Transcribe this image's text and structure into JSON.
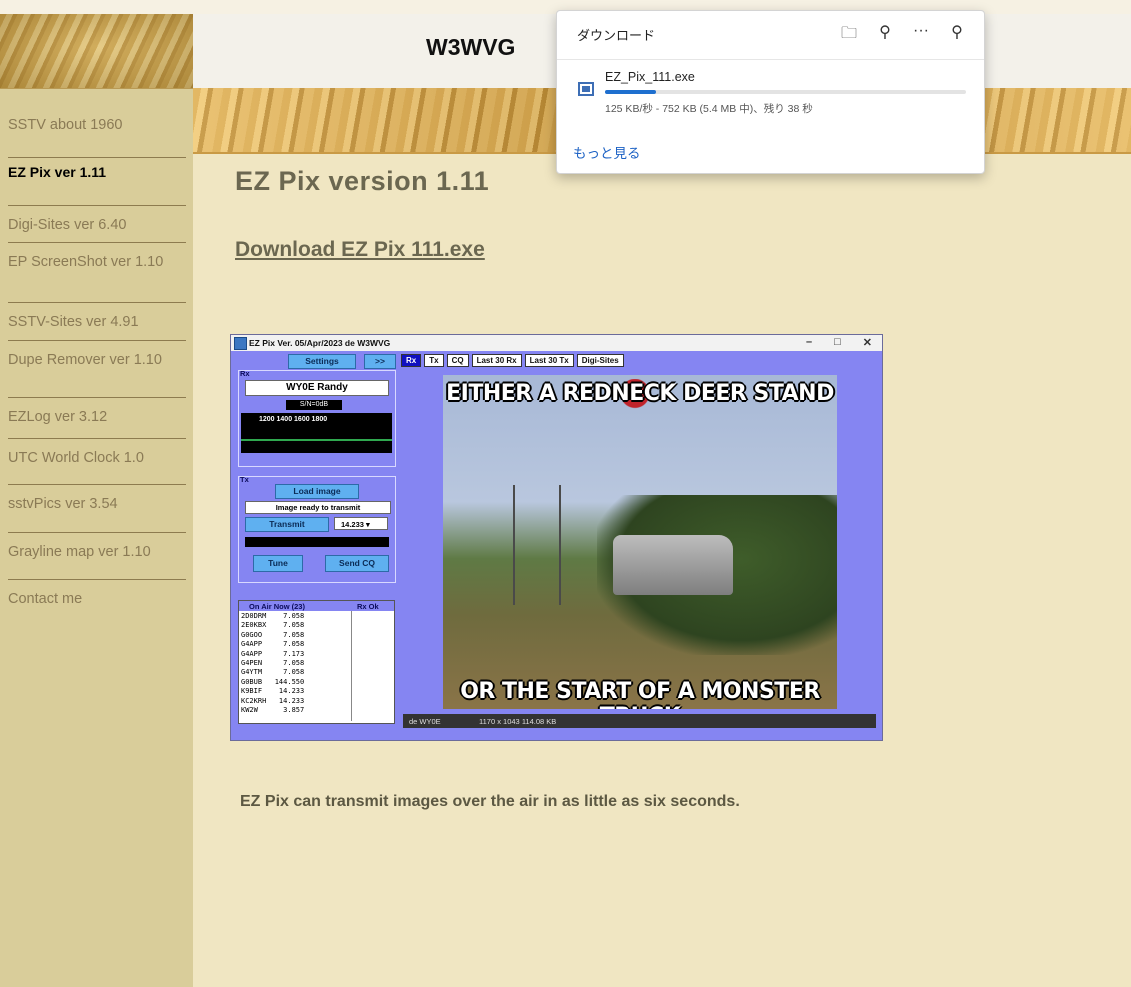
{
  "banner": {
    "title": "W3WVG"
  },
  "sidebar": {
    "items": [
      {
        "label": "SSTV about 1960",
        "top": 0,
        "h": 52
      },
      {
        "label": "EZ Pix ver 1.11",
        "active": true
      },
      {
        "label": "Digi-Sites ver 6.40"
      },
      {
        "label": "EP ScreenShot ver 1.10"
      },
      {
        "label": "SSTV-Sites ver 4.91"
      },
      {
        "label": "Dupe Remover ver 1.10"
      },
      {
        "label": "EZLog ver 3.12"
      },
      {
        "label": "UTC World Clock 1.0"
      },
      {
        "label": "sstvPics ver 3.54"
      },
      {
        "label": "Grayline map ver 1.10"
      },
      {
        "label": "Contact me"
      }
    ]
  },
  "main": {
    "heading": "EZ Pix  version 1.11",
    "download_link": "Download EZ Pix 111.exe",
    "caption": "EZ Pix can transmit images over the air in as little as six seconds."
  },
  "downloads_popup": {
    "title": "ダウンロード",
    "icons": [
      "folder-icon",
      "search-icon",
      "more-icon",
      "pin-icon"
    ],
    "file_name": "EZ_Pix_111.exe",
    "progress": 0.14,
    "status": "125 KB/秒 - 752 KB (5.4 MB 中)、残り 38 秒",
    "more_link": "もっと見る"
  },
  "app_screenshot": {
    "title": "EZ Pix   Ver. 05/Apr/2023 de W3WVG",
    "settings": "Settings",
    "expand": ">>",
    "rx_label": "Rx",
    "callsign": "WY0E  Randy",
    "sn": "S/N=0dB",
    "freqs": "1200   1400   1600   1800",
    "tx_label": "Tx",
    "load_image": "Load image",
    "ready": "Image ready to transmit",
    "transmit": "Transmit",
    "tx_freq": "14.233",
    "tune": "Tune",
    "send_cq": "Send CQ",
    "onair_header": "On Air Now (23)",
    "rxok_header": "Rx Ok",
    "onair_list": [
      "2D0DRM    7.058",
      "2E0KBX    7.058",
      "G0GOO     7.058",
      "G4APP     7.058",
      "G4APP     7.173",
      "G4PEN     7.058",
      "G4YTM     7.058",
      "G0BUB   144.550",
      "K9BIF    14.233",
      "KC2KRH   14.233",
      "KW2W      3.857"
    ],
    "tabs": [
      "Rx",
      "Tx",
      "CQ",
      "Last 30 Rx",
      "Last 30 Tx",
      "Digi-Sites"
    ],
    "meme_top": "EITHER A REDNECK DEER STAND",
    "meme_bottom": "OR THE START OF A MONSTER TRUCK",
    "status_left": "de WY0E",
    "status_right": "1170 x 1043  114.08 KB"
  },
  "colors": {
    "page_bg": "#f0e6c2",
    "sidebar_bg": "#d9cd9a",
    "link": "#6b6750",
    "accent": "#1e6fcf"
  }
}
